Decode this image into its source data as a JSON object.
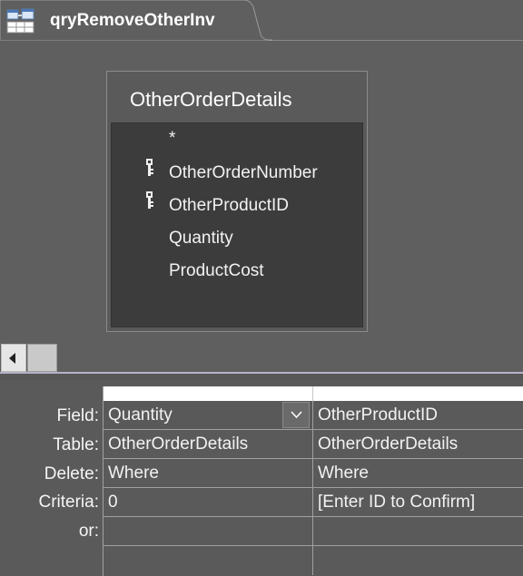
{
  "tab": {
    "title": "qryRemoveOtherInv",
    "icon": "query-design-icon"
  },
  "table": {
    "name": "OtherOrderDetails",
    "fields": [
      {
        "label": "*",
        "primary_key": false
      },
      {
        "label": "OtherOrderNumber",
        "primary_key": true
      },
      {
        "label": "OtherProductID",
        "primary_key": true
      },
      {
        "label": "Quantity",
        "primary_key": false
      },
      {
        "label": "ProductCost",
        "primary_key": false
      }
    ]
  },
  "grid": {
    "row_labels": {
      "field": "Field:",
      "table": "Table:",
      "delete": "Delete:",
      "criteria": "Criteria:",
      "or": "or:"
    },
    "columns": [
      {
        "field": "Quantity",
        "table": "OtherOrderDetails",
        "delete": "Where",
        "criteria": "0",
        "or": ""
      },
      {
        "field": "OtherProductID",
        "table": "OtherOrderDetails",
        "delete": "Where",
        "criteria": "[Enter ID to Confirm]",
        "or": ""
      }
    ]
  },
  "colors": {
    "background": "#5f5f5f",
    "field_list_background": "#3c3c3c",
    "text": "#ffffff"
  }
}
